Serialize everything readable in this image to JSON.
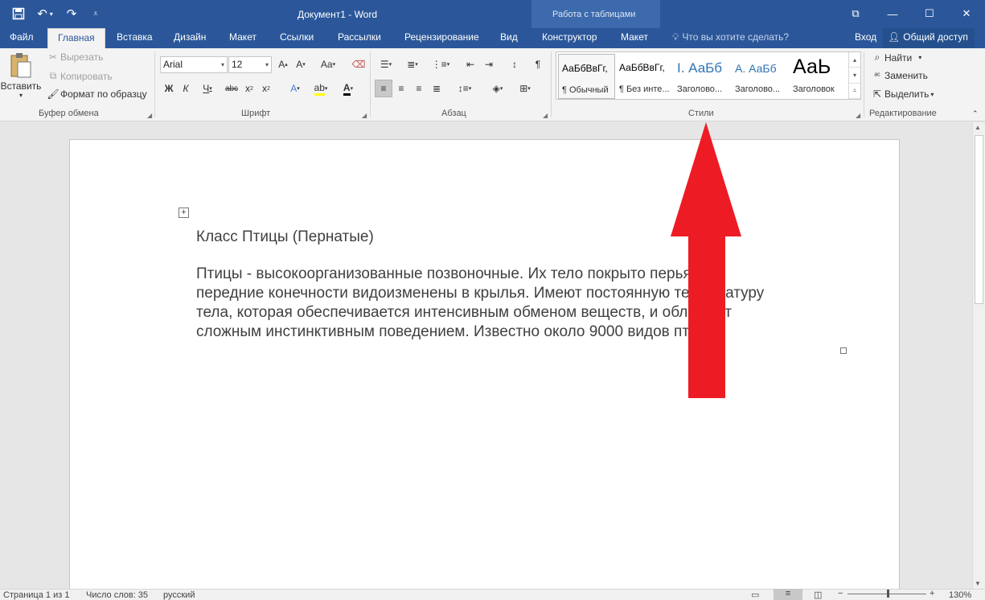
{
  "titlebar": {
    "title": "Документ1 - Word",
    "context_header": "Работа с таблицами"
  },
  "tabs": {
    "file": "Файл",
    "home": "Главная",
    "insert": "Вставка",
    "design": "Дизайн",
    "layout": "Макет",
    "references": "Ссылки",
    "mailings": "Рассылки",
    "review": "Рецензирование",
    "view": "Вид",
    "table_design": "Конструктор",
    "table_layout": "Макет",
    "tell_me": "Что вы хотите сделать?",
    "signin": "Вход",
    "share": "Общий доступ"
  },
  "clipboard": {
    "paste": "Вставить",
    "cut": "Вырезать",
    "copy": "Копировать",
    "format_painter": "Формат по образцу",
    "label": "Буфер обмена"
  },
  "font": {
    "name": "Arial",
    "size": "12",
    "label": "Шрифт"
  },
  "paragraph": {
    "label": "Абзац"
  },
  "styles": {
    "label": "Стили",
    "items": [
      {
        "preview": "АаБбВвГг,",
        "name": "¶ Обычный"
      },
      {
        "preview": "АаБбВвГг,",
        "name": "¶ Без инте..."
      },
      {
        "preview": "I. АаБб",
        "name": "Заголово..."
      },
      {
        "preview": "А. АаБб",
        "name": "Заголово..."
      },
      {
        "preview": "АаЬ",
        "name": "Заголовок"
      }
    ]
  },
  "editing": {
    "find": "Найти",
    "replace": "Заменить",
    "select": "Выделить",
    "label": "Редактирование"
  },
  "document": {
    "heading": "Класс Птицы (Пернатые)",
    "lines": [
      "Птицы - высокоорганизованные позвоночные. Их тело покрыто перьями,",
      "передние конечности видоизменены в крылья. Имеют постоянную температуру",
      "тела, которая обеспечивается интенсивным обменом веществ, и обладают",
      "сложным инстинктивным поведением. Известно около 9000 видов птиц."
    ]
  },
  "status": {
    "page": "Страница 1 из 1",
    "words": "Число слов: 35",
    "language": "русский",
    "zoom": "130%"
  },
  "colors": {
    "brand": "#2b579a",
    "annotation_arrow": "#ed1c24"
  }
}
